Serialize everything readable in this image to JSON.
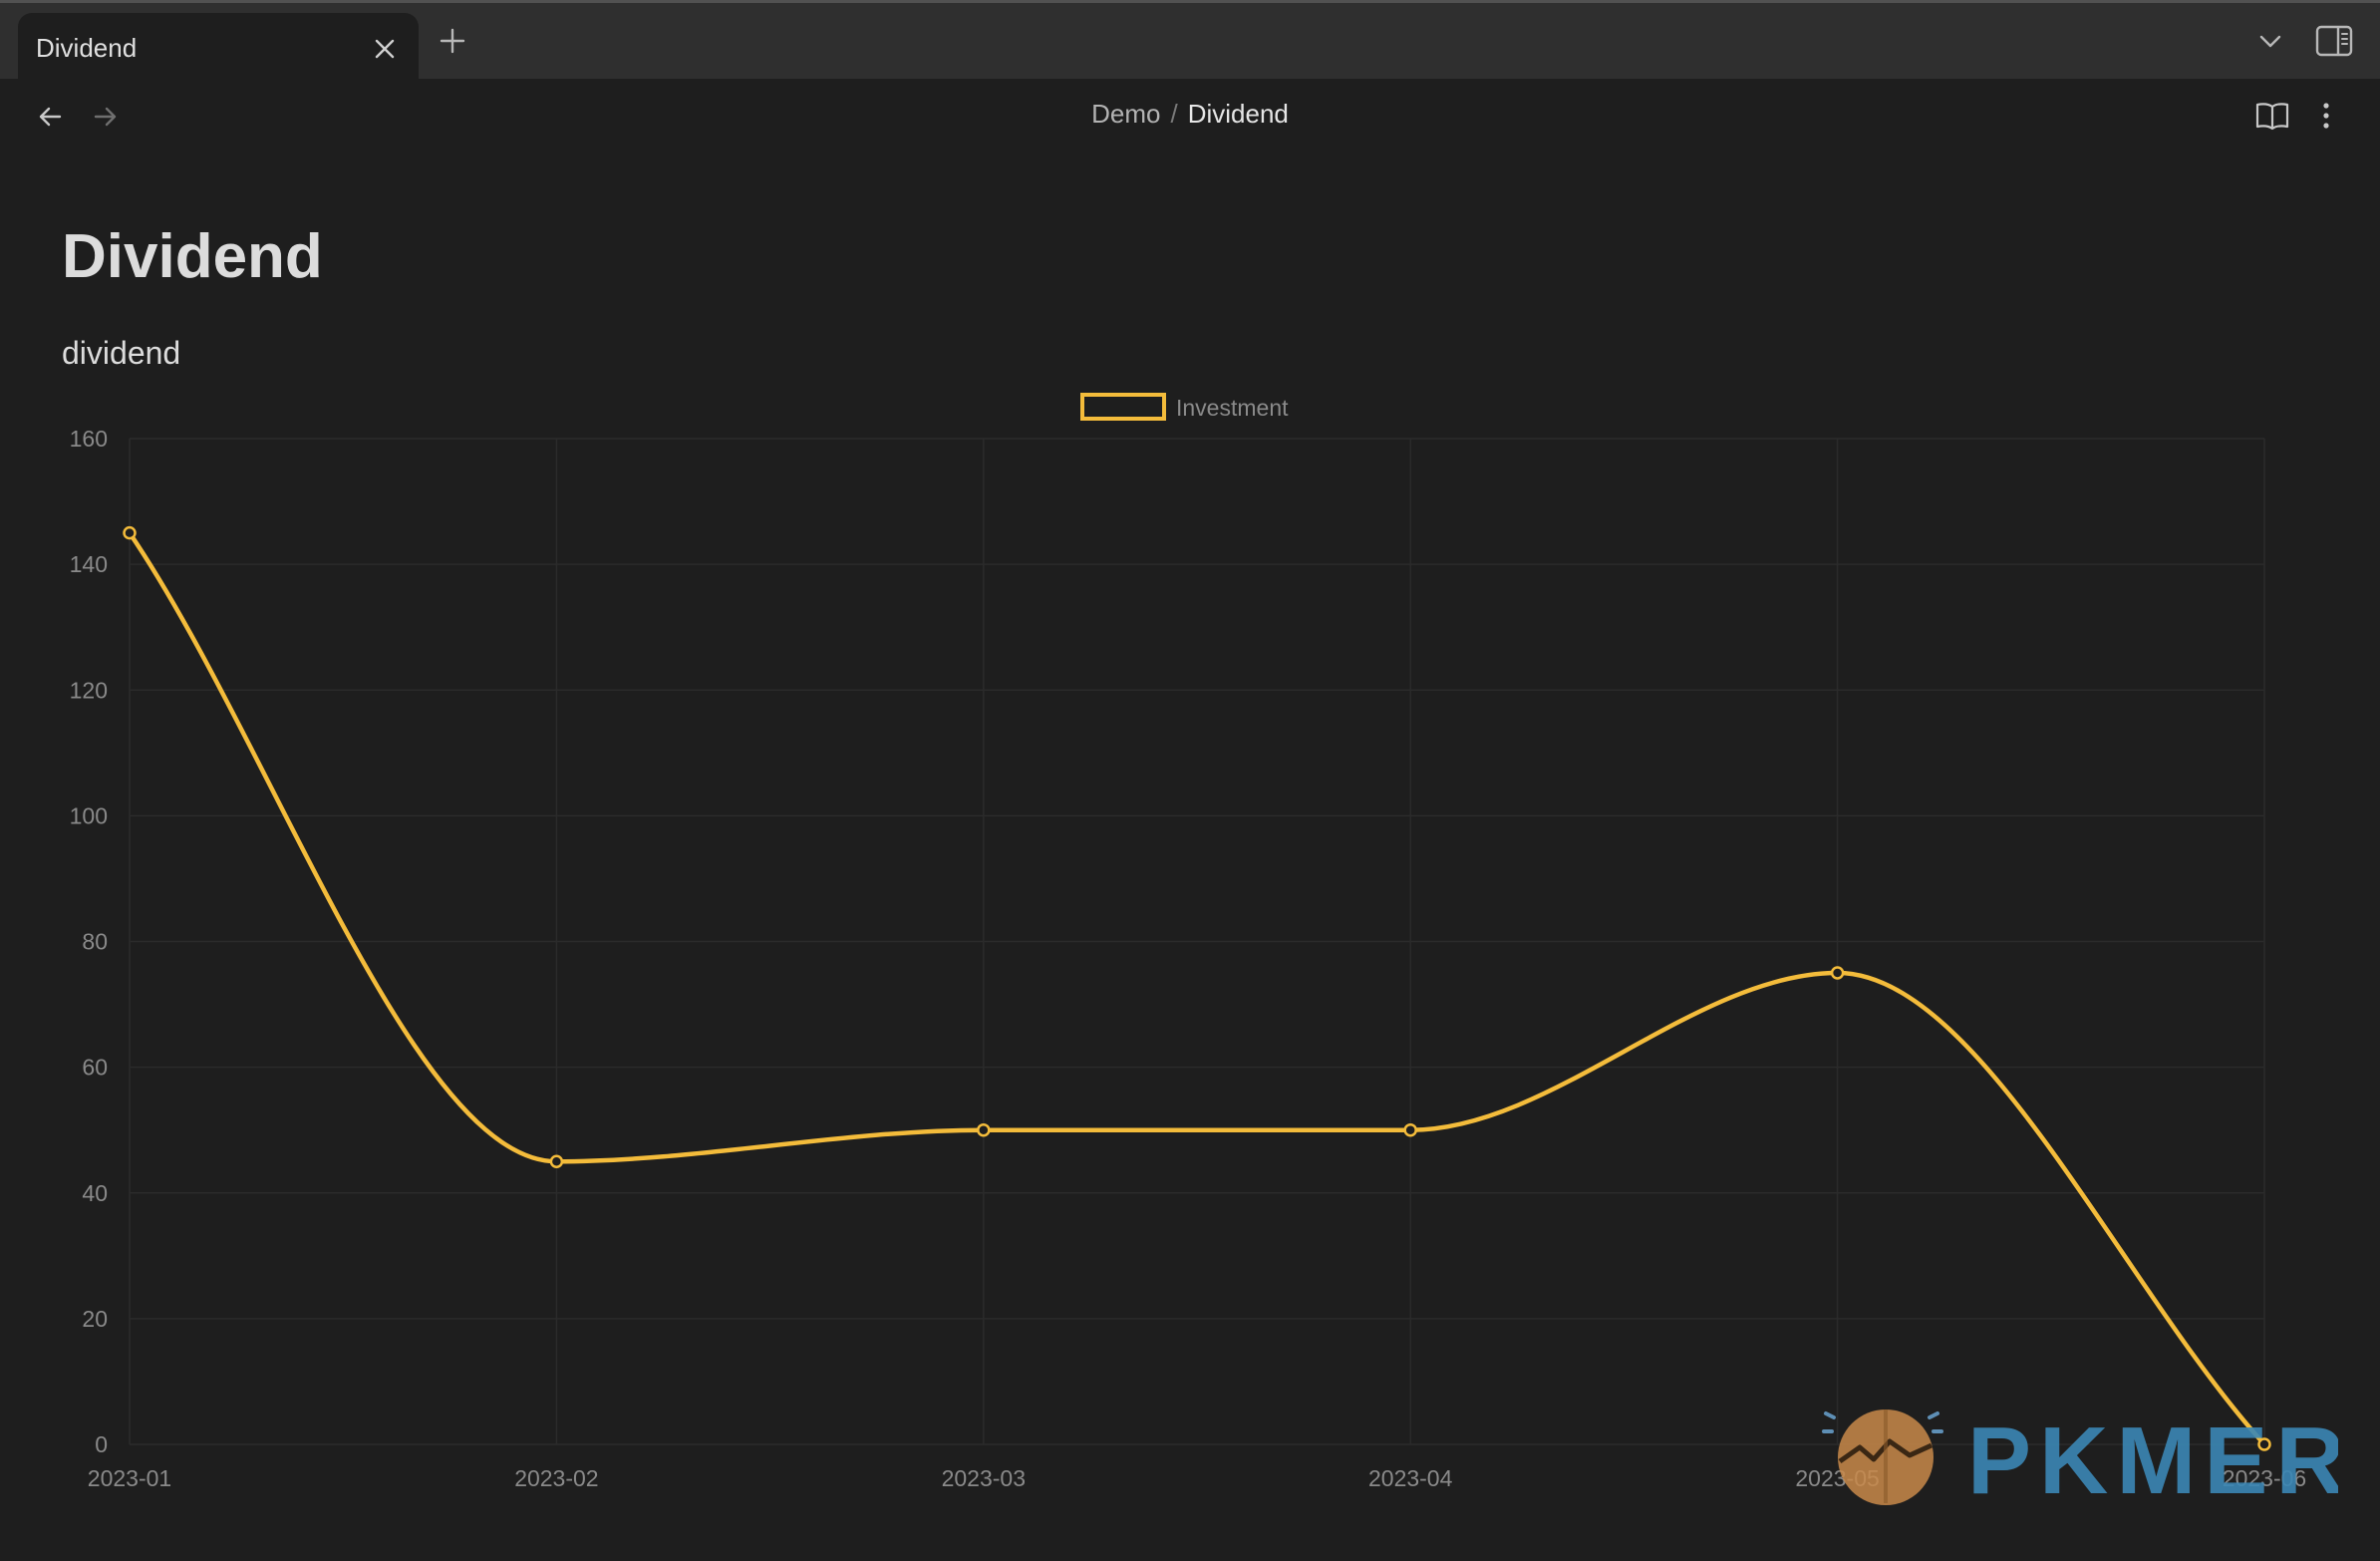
{
  "tab": {
    "title": "Dividend"
  },
  "breadcrumb": {
    "parent": "Demo",
    "separator": "/",
    "current": "Dividend"
  },
  "page": {
    "title": "Dividend",
    "subtitle": "dividend"
  },
  "watermark": {
    "text": "PKMER"
  },
  "colors": {
    "accent": "#f4bc3b",
    "background": "#1e1e1e",
    "tabbar": "#2f2f2f",
    "watermark_text": "#3b87b5"
  },
  "chart_data": {
    "type": "line",
    "categories": [
      "2023-01",
      "2023-02",
      "2023-03",
      "2023-04",
      "2023-05",
      "2023-06"
    ],
    "series": [
      {
        "name": "Investment",
        "values": [
          145,
          45,
          50,
          50,
          75,
          0
        ],
        "color": "#f4bc3b"
      }
    ],
    "yticks": [
      0,
      20,
      40,
      60,
      80,
      100,
      120,
      140,
      160
    ],
    "ylim": [
      0,
      160
    ],
    "smooth": true,
    "grid": true,
    "legend": "top-center"
  }
}
